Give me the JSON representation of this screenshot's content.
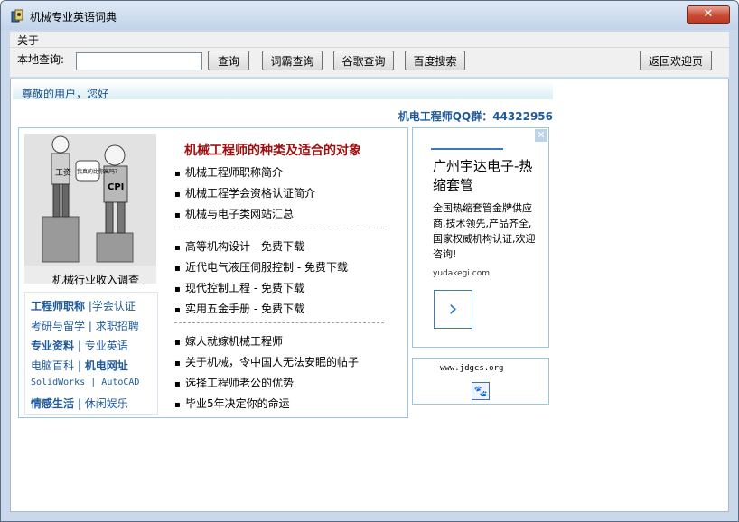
{
  "window": {
    "title": "机械专业英语词典",
    "close_label": "✕"
  },
  "menu": {
    "about": "关于"
  },
  "toolbar": {
    "local_query_label": "本地查询:",
    "search_value": "",
    "query_btn": "查询",
    "iciba_btn": "词霸查询",
    "google_btn": "谷歌查询",
    "baidu_btn": "百度搜索",
    "home_btn": "返回欢迎页"
  },
  "content": {
    "greeting": "尊敬的用户，您好",
    "qq_group": "机电工程师QQ群：44322956",
    "cartoon": {
      "speech": "我真的比你高吗？",
      "left_label": "工资",
      "right_label": "CPI",
      "caption": "机械行业收入调查"
    },
    "categories": {
      "row1": [
        "工程师职称",
        "学会认证"
      ],
      "row2": [
        "考研与留学",
        "求职招聘"
      ],
      "row3": [
        "专业资料",
        "专业英语"
      ],
      "row4": [
        "电脑百科",
        "机电网址"
      ],
      "row5": [
        "SolidWorks",
        "AutoCAD"
      ],
      "row6": [
        "情感生活",
        "休闲娱乐"
      ]
    },
    "section_title": "机械工程师的种类及适合的对象",
    "articles_group1": [
      "机械工程师职称简介",
      "机械工程学会资格认证简介",
      "机械与电子类网站汇总"
    ],
    "articles_group2": [
      "高等机构设计 - 免费下载",
      "近代电气液压伺服控制 - 免费下载",
      "现代控制工程 - 免费下载",
      "实用五金手册 - 免费下载"
    ],
    "articles_group3": [
      "嫁人就嫁机械工程师",
      "关于机械，令中国人无法安眠的帖子",
      "选择工程师老公的优势",
      "毕业5年决定你的命运"
    ],
    "ad": {
      "title": "广州宇达电子-热缩套管",
      "body": "全国热缩套管金牌供应商,技术领先,产品齐全,国家权威机构认证,欢迎咨询!",
      "url": "yudakegi.com",
      "close": "✕",
      "arrow": "›"
    },
    "site_url": "www.jdgcs.org",
    "site_icon": "🐾"
  }
}
